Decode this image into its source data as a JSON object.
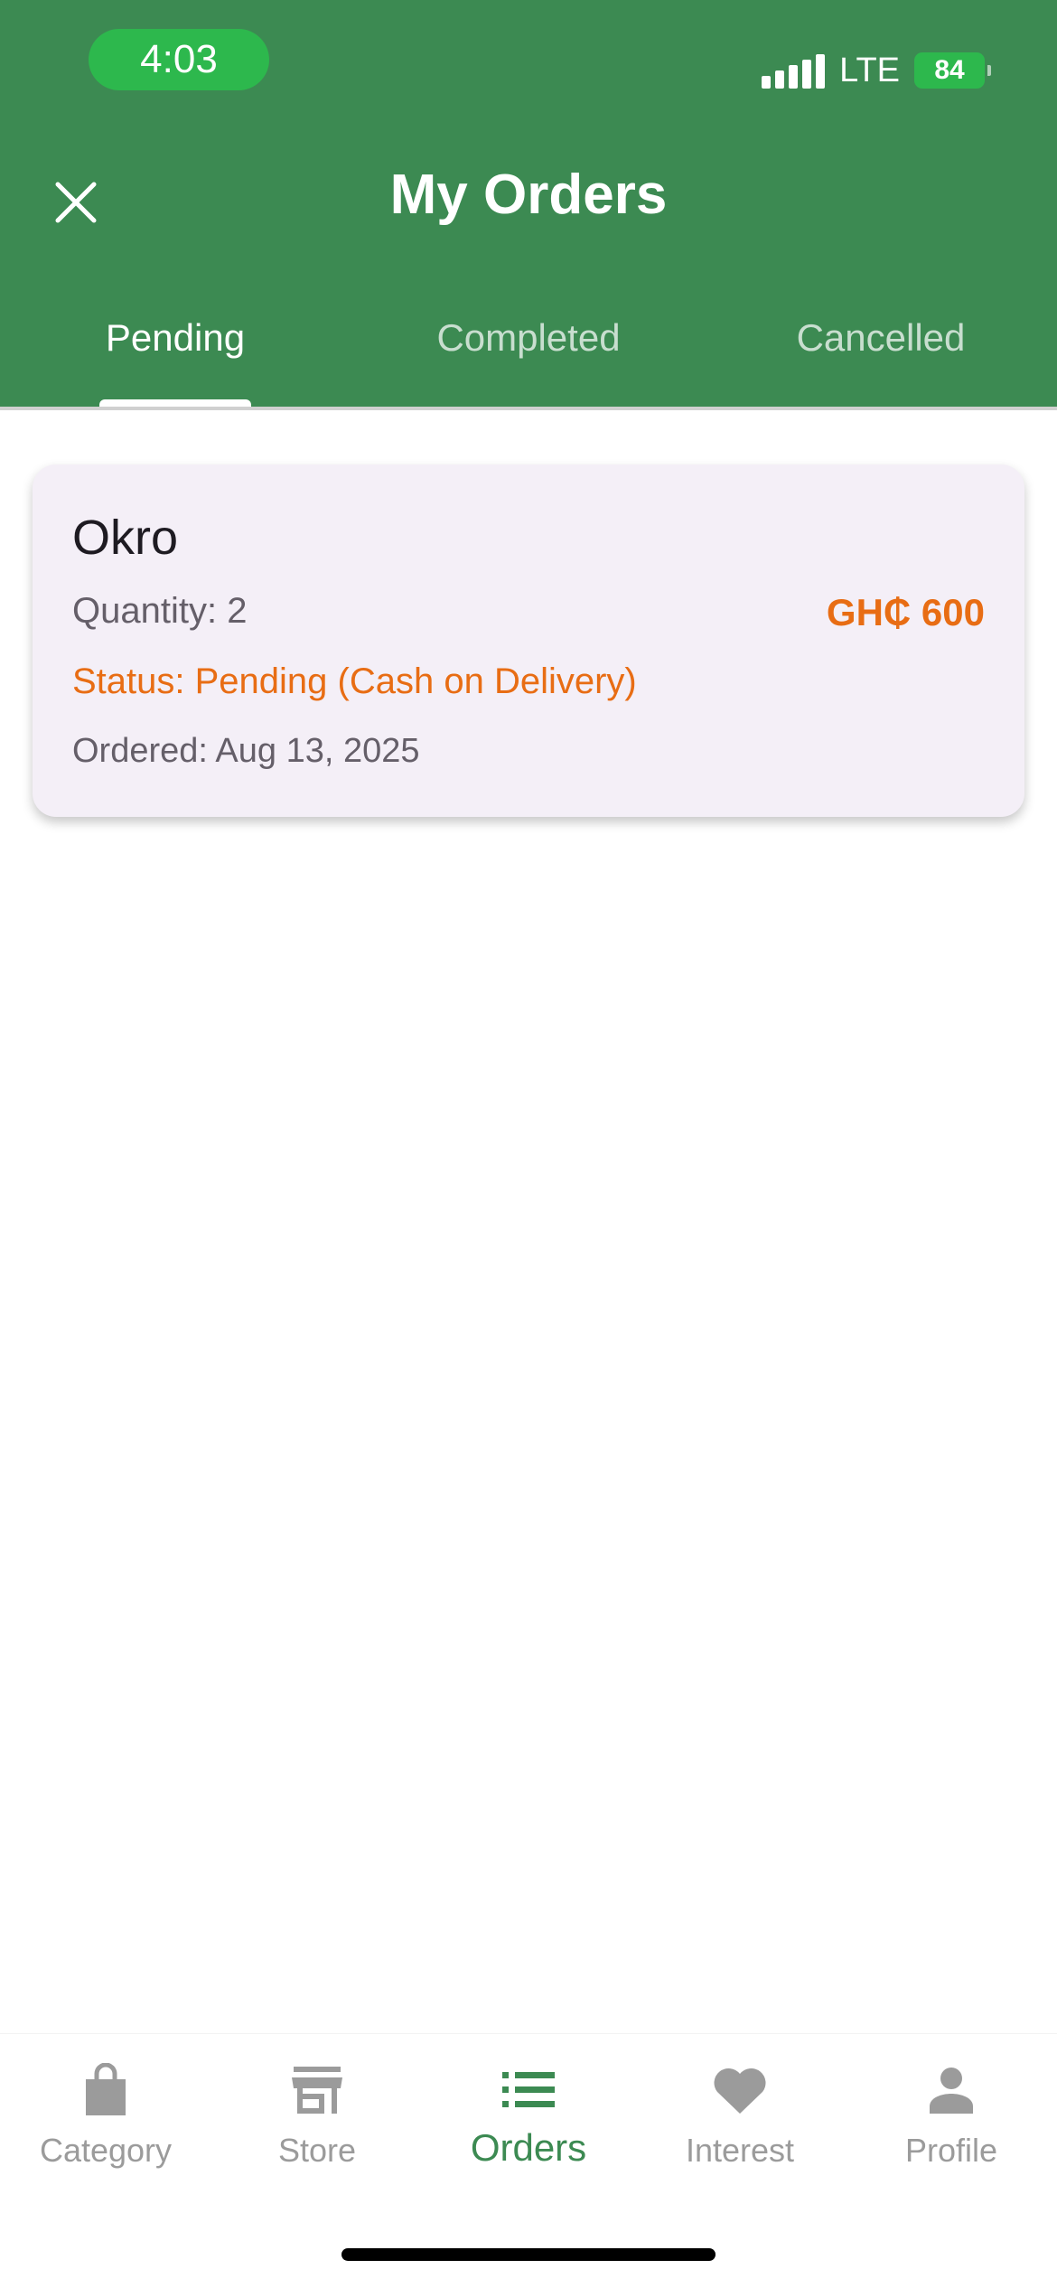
{
  "status_bar": {
    "time": "4:03",
    "network": "LTE",
    "battery": "84"
  },
  "header": {
    "title": "My Orders"
  },
  "tabs": [
    {
      "label": "Pending",
      "active": true
    },
    {
      "label": "Completed",
      "active": false
    },
    {
      "label": "Cancelled",
      "active": false
    }
  ],
  "orders": [
    {
      "name": "Okro",
      "quantity": "Quantity: 2",
      "price": "GH₵ 600",
      "status": "Status: Pending (Cash on Delivery)",
      "ordered": "Ordered: Aug 13, 2025"
    }
  ],
  "bottom_nav": [
    {
      "label": "Category",
      "icon": "shopping-bag-icon",
      "active": false
    },
    {
      "label": "Store",
      "icon": "store-icon",
      "active": false
    },
    {
      "label": "Orders",
      "icon": "list-icon",
      "active": true
    },
    {
      "label": "Interest",
      "icon": "heart-icon",
      "active": false
    },
    {
      "label": "Profile",
      "icon": "person-icon",
      "active": false
    }
  ],
  "colors": {
    "header_green": "#3c8a52",
    "accent_orange": "#e86d14",
    "card_bg": "#f4eff7",
    "inactive_gray": "#9b9b9b"
  }
}
